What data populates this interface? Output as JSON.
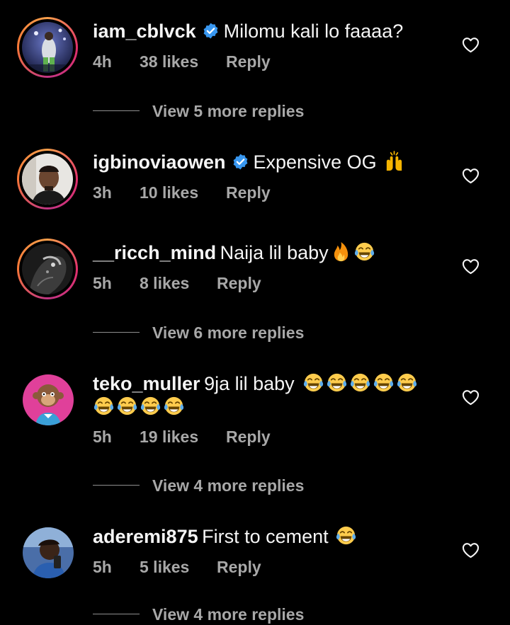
{
  "comments": [
    {
      "username": "iam_cblvck",
      "verified": true,
      "text": "Milomu kali lo faaaa?",
      "time": "4h",
      "likes": "38 likes",
      "reply": "Reply",
      "view_replies": "View 5 more replies"
    },
    {
      "username": "igbinoviaowen",
      "verified": true,
      "text": "Expensive OG",
      "emojis": [
        "raising-hands-icon"
      ],
      "time": "3h",
      "likes": "10 likes",
      "reply": "Reply"
    },
    {
      "username": "__ricch_mind",
      "verified": false,
      "text": "Naija lil baby",
      "emojis": [
        "fire-icon",
        "tears-of-joy-icon"
      ],
      "time": "5h",
      "likes": "8 likes",
      "reply": "Reply",
      "view_replies": "View 6 more replies"
    },
    {
      "username": "teko_muller",
      "verified": false,
      "text": "9ja lil baby",
      "emojis": [
        "tears-of-joy-icon",
        "tears-of-joy-icon",
        "tears-of-joy-icon",
        "tears-of-joy-icon",
        "tears-of-joy-icon",
        "tears-of-joy-icon",
        "tears-of-joy-icon",
        "tears-of-joy-icon",
        "tears-of-joy-icon"
      ],
      "time": "5h",
      "likes": "19 likes",
      "reply": "Reply",
      "view_replies": "View 4 more replies"
    },
    {
      "username": "aderemi875",
      "verified": false,
      "text": "First to cement",
      "emojis": [
        "tears-of-joy-icon"
      ],
      "time": "5h",
      "likes": "5 likes",
      "reply": "Reply",
      "view_replies": "View 4 more replies"
    }
  ],
  "colors": {
    "background": "#000000",
    "primary_text": "#f5f5f5",
    "secondary_text": "#a8a8a8",
    "verified_badge": "#3897f0",
    "story_ring": "#e1306c"
  }
}
